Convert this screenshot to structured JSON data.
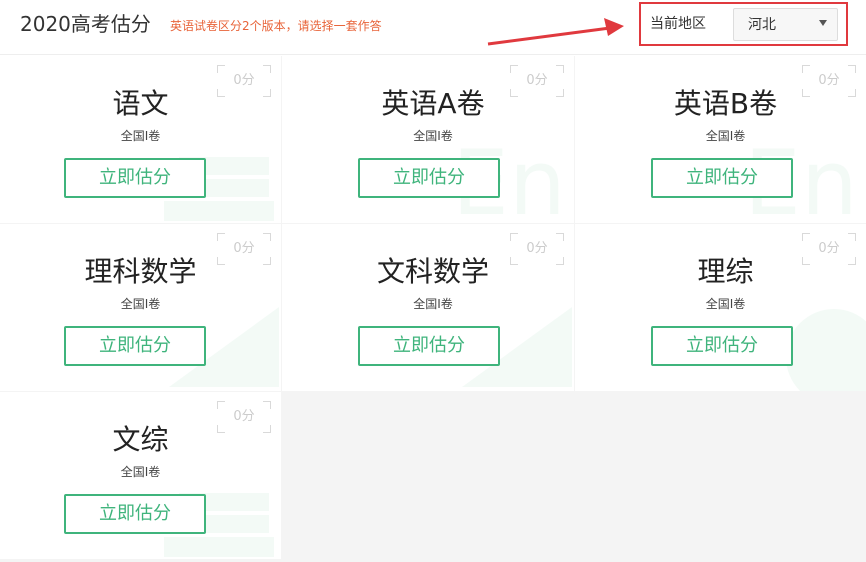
{
  "header": {
    "title": "2020高考估分",
    "notice": "英语试卷区分2个版本，请选择一套作答",
    "region_label": "当前地区",
    "region_value": "河北"
  },
  "colors": {
    "accent_green": "#3fb47c",
    "notice_orange": "#e8643a",
    "highlight_red": "#e0393e"
  },
  "cards": [
    {
      "subject": "语文",
      "paper": "全国I卷",
      "score": "0分",
      "button": "立即估分",
      "watermark": "books-icon"
    },
    {
      "subject": "英语A卷",
      "paper": "全国I卷",
      "score": "0分",
      "button": "立即估分",
      "watermark": "en-letters-icon"
    },
    {
      "subject": "英语B卷",
      "paper": "全国I卷",
      "score": "0分",
      "button": "立即估分",
      "watermark": "en-letters-icon"
    },
    {
      "subject": "理科数学",
      "paper": "全国I卷",
      "score": "0分",
      "button": "立即估分",
      "watermark": "ruler-icon"
    },
    {
      "subject": "文科数学",
      "paper": "全国I卷",
      "score": "0分",
      "button": "立即估分",
      "watermark": "ruler-icon"
    },
    {
      "subject": "理综",
      "paper": "全国I卷",
      "score": "0分",
      "button": "立即估分",
      "watermark": "globe-icon"
    },
    {
      "subject": "文综",
      "paper": "全国I卷",
      "score": "0分",
      "button": "立即估分",
      "watermark": "books-icon"
    }
  ]
}
